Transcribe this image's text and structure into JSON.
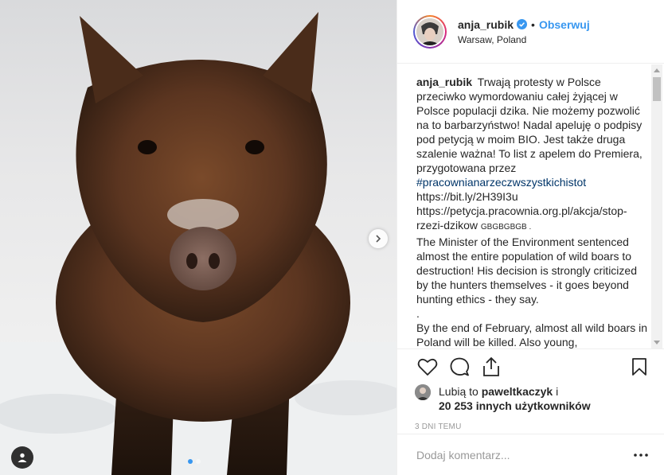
{
  "post": {
    "author": {
      "username": "anja_rubik",
      "verified_icon": "verified-badge-icon",
      "separator": "•",
      "follow_label": "Obserwuj",
      "location": "Warsaw, Poland"
    },
    "image": {
      "subject": "wild boar in snow",
      "carousel_total": 2,
      "carousel_active": 1
    },
    "caption": {
      "username": "anja_rubik",
      "text_part1": "Trwają protesty w Polsce przeciwko wymordowaniu całej żyjącej w Polsce populacji dzika. Nie możemy pozwolić na to barbarzyństwo! Nadal apeluję o podpisy pod petycją w moim BIO. Jest także druga szalenie ważna! To list z apelem do Premiera, przygotowana przez",
      "hashtag": "#pracownianarzeczwszystkichistot",
      "link1": "https://bit.ly/2H39I3u",
      "link2": "https://petycja.pracownia.org.pl/akcja/stop-rzezi-dzikow",
      "flags": "GBGBGBGB .",
      "text_en": "The Minister of the Environment sentenced almost the entire population of wild boars to destruction! His decision is strongly criticized by the hunters themselves - it goes beyond hunting ethics - they say.",
      "dot": ".",
      "text_en2": "By the end of February, almost all wild boars in Poland will be killed. Also young,"
    },
    "likes": {
      "prefix": "Lubią to",
      "user": "paweltkaczyk",
      "conj": "i",
      "count_text": "20 253 innych użytkowników"
    },
    "timestamp": "3 dni temu",
    "comment_box": {
      "placeholder": "Dodaj komentarz..."
    }
  },
  "colors": {
    "accent": "#3897f0",
    "text": "#262626",
    "muted": "#999999",
    "border": "#efefef"
  }
}
